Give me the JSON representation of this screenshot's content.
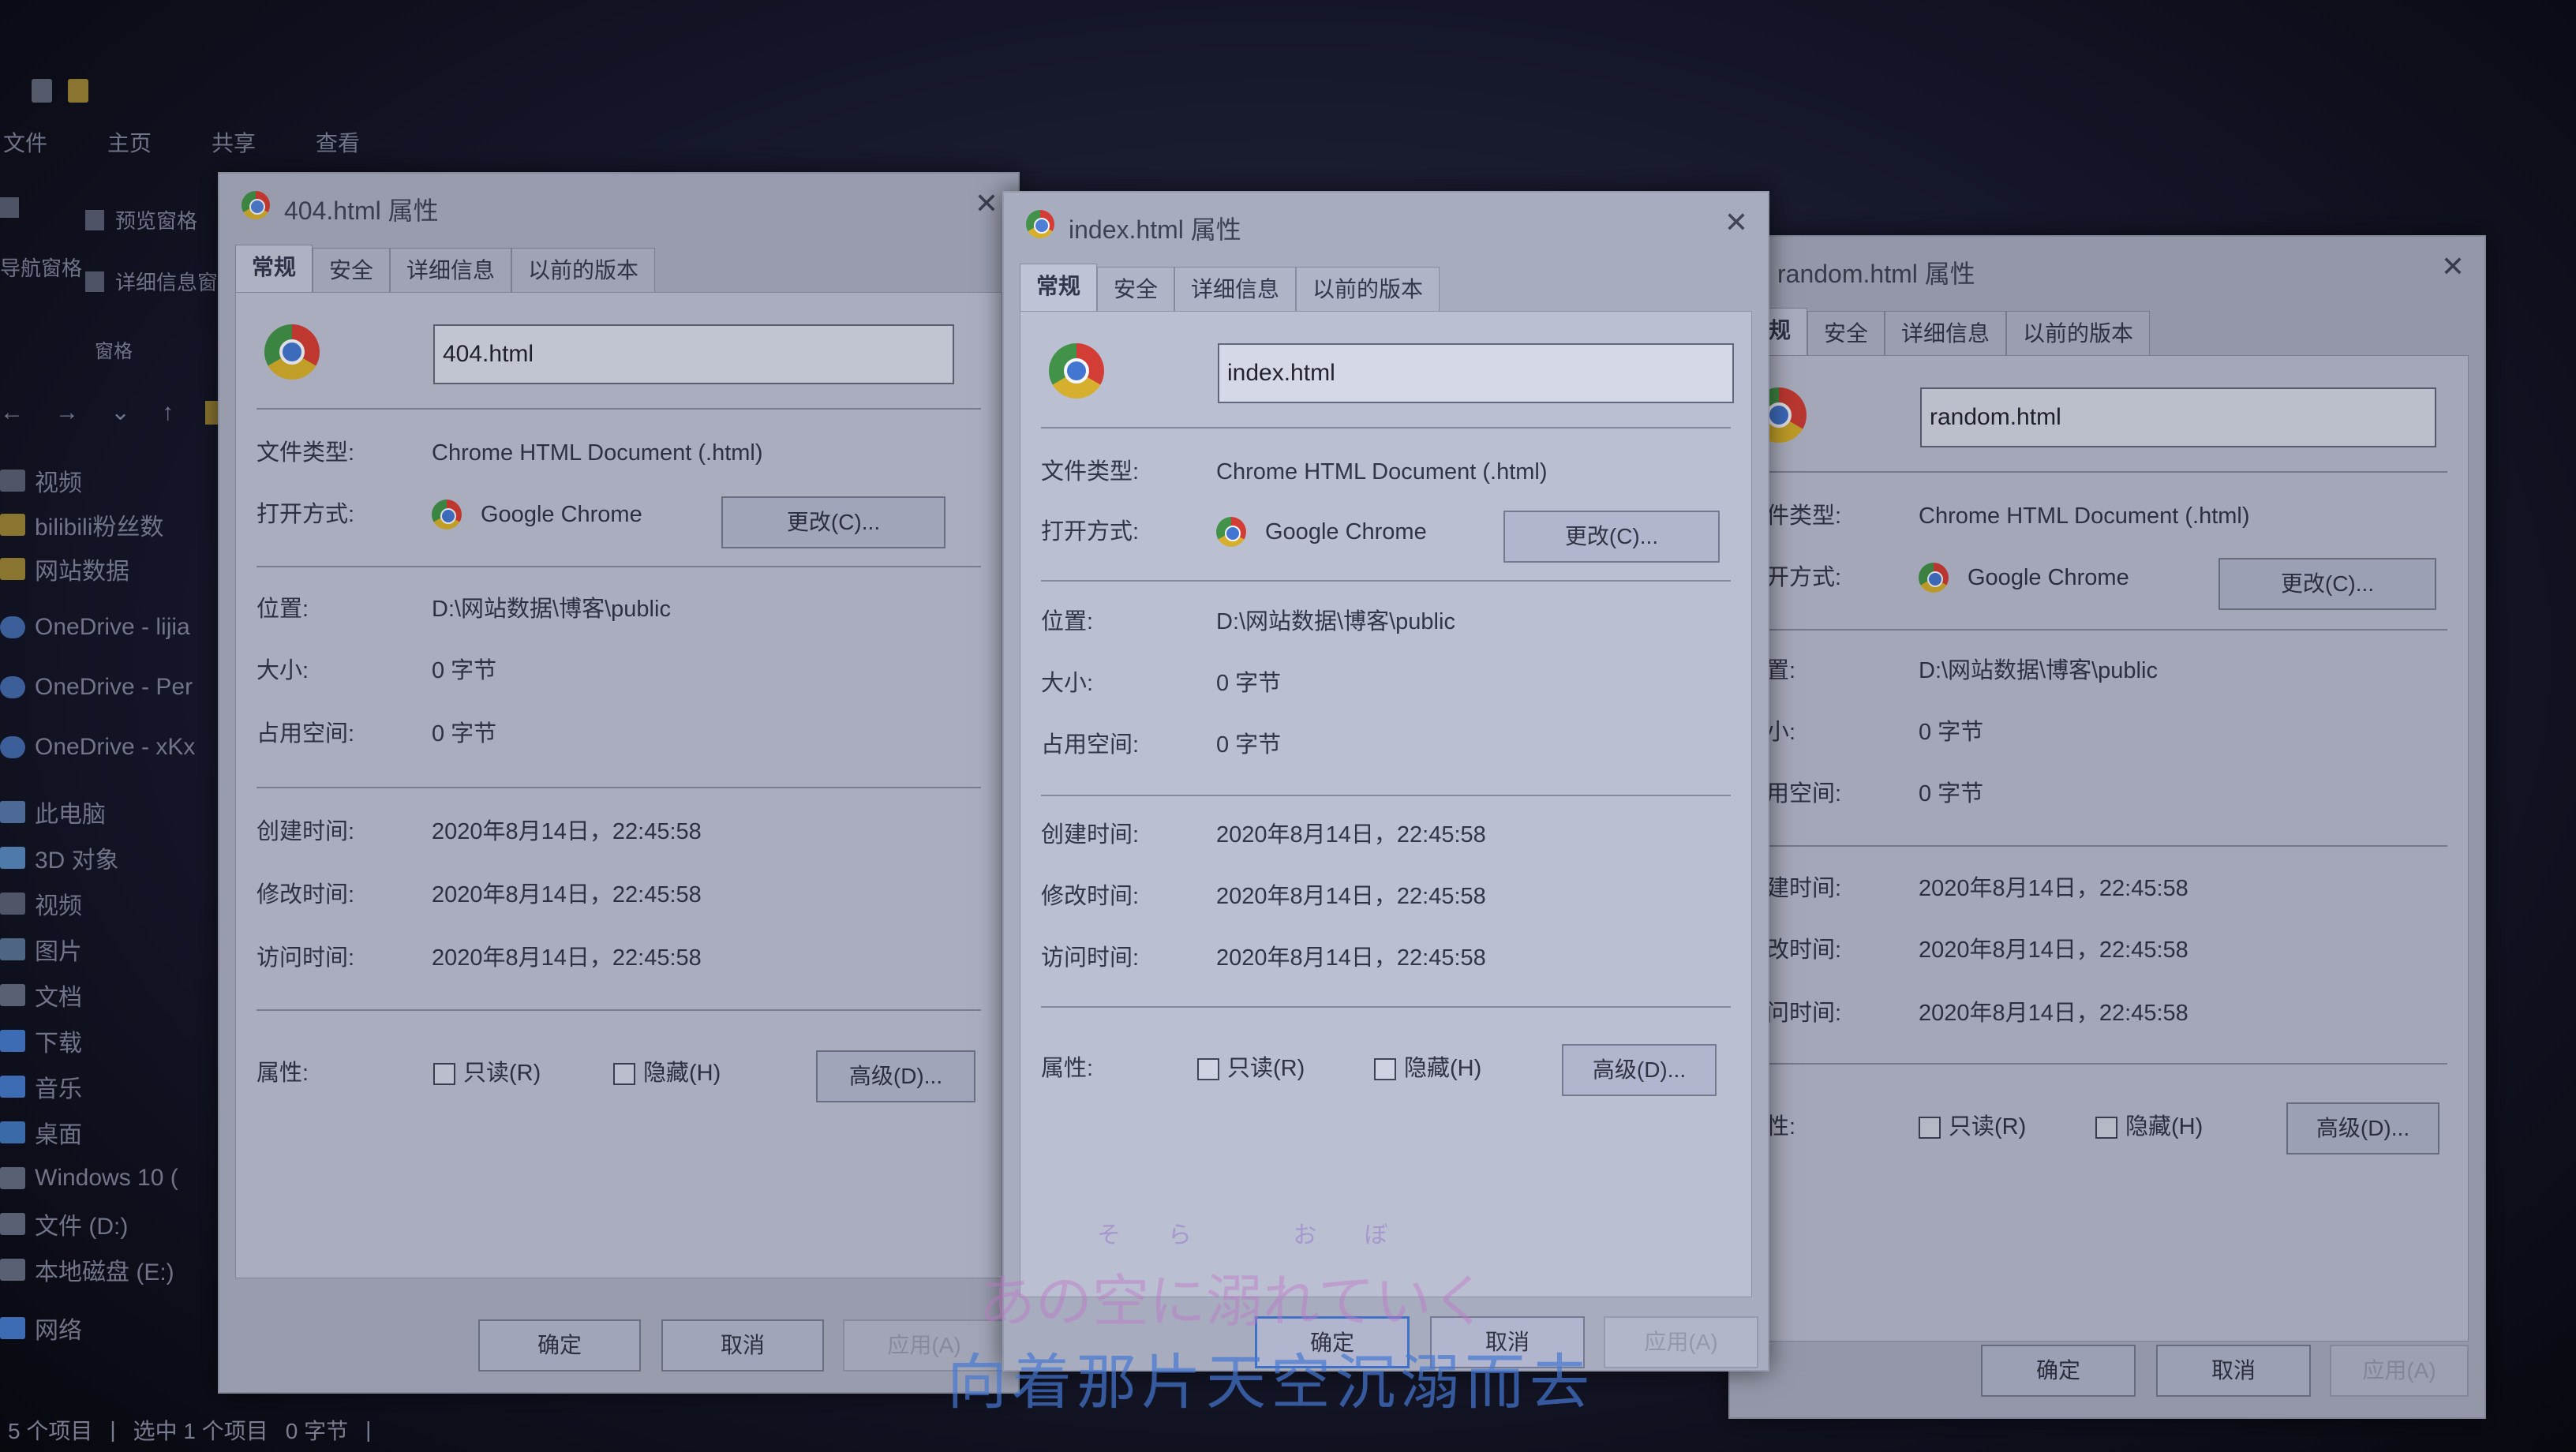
{
  "explorer": {
    "ribbon_tabs": [
      "文件",
      "主页",
      "共享",
      "查看"
    ],
    "ribbon_items": [
      "预览窗格",
      "详细信息窗格"
    ],
    "ribbon_left_label": "导航窗格",
    "ribbon_group": "窗格",
    "sidebar": [
      {
        "label": "视频",
        "icon": "video-icon"
      },
      {
        "label": "bilibili粉丝数",
        "icon": "folder-icon"
      },
      {
        "label": "网站数据",
        "icon": "folder-icon"
      },
      {
        "label": "OneDrive - lijia",
        "icon": "cloud-icon"
      },
      {
        "label": "OneDrive - Per",
        "icon": "cloud-icon"
      },
      {
        "label": "OneDrive - xKx",
        "icon": "cloud-icon"
      },
      {
        "label": "此电脑",
        "icon": "computer-icon"
      },
      {
        "label": "3D 对象",
        "icon": "cube-icon"
      },
      {
        "label": "视频",
        "icon": "video-icon"
      },
      {
        "label": "图片",
        "icon": "picture-icon"
      },
      {
        "label": "文档",
        "icon": "document-icon"
      },
      {
        "label": "下载",
        "icon": "download-icon"
      },
      {
        "label": "音乐",
        "icon": "music-icon"
      },
      {
        "label": "桌面",
        "icon": "desktop-icon"
      },
      {
        "label": "Windows 10 (",
        "icon": "drive-icon"
      },
      {
        "label": "文件 (D:)",
        "icon": "drive-icon"
      },
      {
        "label": "本地磁盘 (E:)",
        "icon": "drive-icon"
      },
      {
        "label": "网络",
        "icon": "network-icon"
      }
    ],
    "status": {
      "items": "5 个项目",
      "selected": "选中 1 个项目",
      "size": "0 字节"
    }
  },
  "dialogs": [
    {
      "title": "404.html 属性",
      "tabs": [
        "常规",
        "安全",
        "详细信息",
        "以前的版本"
      ],
      "filename": "404.html",
      "labels": {
        "type": "文件类型:",
        "open_with": "打开方式:",
        "location": "位置:",
        "size": "大小:",
        "disk_size": "占用空间:",
        "created": "创建时间:",
        "modified": "修改时间:",
        "accessed": "访问时间:",
        "attributes": "属性:"
      },
      "file_type": "Chrome HTML Document (.html)",
      "open_with": "Google Chrome",
      "change_button": "更改(C)...",
      "location": "D:\\网站数据\\博客\\public",
      "size": "0 字节",
      "disk_size": "0 字节",
      "created": "2020年8月14日，22:45:58",
      "modified": "2020年8月14日，22:45:58",
      "accessed": "2020年8月14日，22:45:58",
      "readonly": "只读(R)",
      "hidden": "隐藏(H)",
      "advanced_button": "高级(D)...",
      "ok": "确定",
      "cancel": "取消",
      "apply": "应用(A)"
    },
    {
      "title": "index.html 属性",
      "tabs": [
        "常规",
        "安全",
        "详细信息",
        "以前的版本"
      ],
      "filename": "index.html",
      "labels": {
        "type": "文件类型:",
        "open_with": "打开方式:",
        "location": "位置:",
        "size": "大小:",
        "disk_size": "占用空间:",
        "created": "创建时间:",
        "modified": "修改时间:",
        "accessed": "访问时间:",
        "attributes": "属性:"
      },
      "file_type": "Chrome HTML Document (.html)",
      "open_with": "Google Chrome",
      "change_button": "更改(C)...",
      "location": "D:\\网站数据\\博客\\public",
      "size": "0 字节",
      "disk_size": "0 字节",
      "created": "2020年8月14日，22:45:58",
      "modified": "2020年8月14日，22:45:58",
      "accessed": "2020年8月14日，22:45:58",
      "readonly": "只读(R)",
      "hidden": "隐藏(H)",
      "advanced_button": "高级(D)...",
      "ok": "确定",
      "cancel": "取消",
      "apply": "应用(A)"
    },
    {
      "title": "random.html 属性",
      "tabs": [
        "常规",
        "安全",
        "详细信息",
        "以前的版本"
      ],
      "filename": "random.html",
      "labels": {
        "type": "文件类型:",
        "open_with": "打开方式:",
        "location": "位置:",
        "size": "大小:",
        "disk_size": "占用空间:",
        "created": "创建时间:",
        "modified": "修改时间:",
        "accessed": "访问时间:",
        "attributes": "属性:"
      },
      "file_type": "Chrome HTML Document (.html)",
      "open_with": "Google Chrome",
      "change_button": "更改(C)...",
      "location": "D:\\网站数据\\博客\\public",
      "size": "0 字节",
      "disk_size": "0 字节",
      "created": "2020年8月14日，22:45:58",
      "modified": "2020年8月14日，22:45:58",
      "accessed": "2020年8月14日，22:45:58",
      "readonly": "只读(R)",
      "hidden": "隐藏(H)",
      "advanced_button": "高级(D)...",
      "ok": "确定",
      "cancel": "取消",
      "apply": "应用(A)"
    }
  ],
  "lyrics": {
    "ruby": "そら おぼ",
    "japanese": "あの空に溺れていく",
    "chinese": "向着那片天空沉溺而去"
  }
}
